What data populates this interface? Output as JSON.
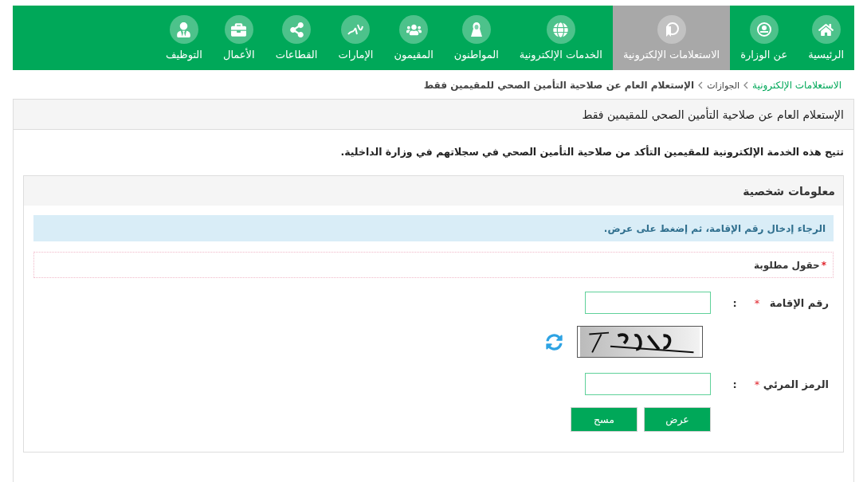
{
  "nav": {
    "items": [
      {
        "label": "الرئيسية",
        "selected": false
      },
      {
        "label": "عن الوزارة",
        "selected": false
      },
      {
        "label": "الاستعلامات الإلكترونية",
        "selected": true
      },
      {
        "label": "الخدمات الإلكترونية",
        "selected": false
      },
      {
        "label": "المواطنون",
        "selected": false
      },
      {
        "label": "المقيمون",
        "selected": false
      },
      {
        "label": "الإمارات",
        "selected": false
      },
      {
        "label": "القطاعات",
        "selected": false
      },
      {
        "label": "الأعمال",
        "selected": false
      },
      {
        "label": "التوظيف",
        "selected": false
      }
    ]
  },
  "breadcrumb": [
    {
      "label": "الاستعلامات الإلكترونية",
      "kind": "section"
    },
    {
      "label": "الجوازات",
      "kind": "link"
    },
    {
      "label": "الإستعلام العام عن صلاحية التأمين الصحي للمقيمين فقط",
      "kind": "current"
    }
  ],
  "page": {
    "title": "الإستعلام العام عن صلاحية التأمين الصحي للمقيمين فقط",
    "description": "تتيح هذه الخدمة الإلكترونية للمقيمين التأكد من صلاحية التأمين الصحي في سجلاتهم في وزارة الداخلية."
  },
  "form": {
    "title": "معلومات شخصية",
    "info": "الرجاء إدخال رقم الإقامة، ثم إضغط على عرض.",
    "required_note": {
      "star": "*",
      "label": "حقول مطلوبة"
    },
    "fields": [
      {
        "kind": "input",
        "label": "رقم الإقامة",
        "star": "*",
        "colon": ":"
      },
      {
        "kind": "captcha"
      },
      {
        "kind": "input",
        "label": "الرمز المرئي",
        "star": "*",
        "colon": ":"
      }
    ],
    "buttons": [
      {
        "label": "عرض"
      },
      {
        "label": "مسح"
      }
    ]
  }
}
